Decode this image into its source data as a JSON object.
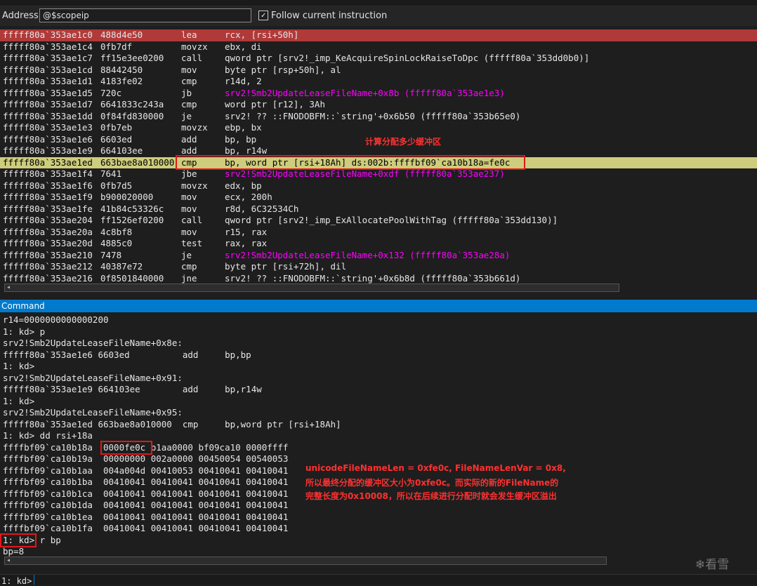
{
  "address_bar": {
    "label": "Address:",
    "value": "@$scopeip",
    "follow_checked": "✓",
    "follow_label": "Follow current instruction"
  },
  "disassembly": [
    {
      "addr": "fffff80a`353ae1c0",
      "bytes": "488d4e50",
      "mn": "lea",
      "op": "rcx, [rsi+50h]",
      "state": "current"
    },
    {
      "addr": "fffff80a`353ae1c4",
      "bytes": "0fb7df",
      "mn": "movzx",
      "op": "ebx, di"
    },
    {
      "addr": "fffff80a`353ae1c7",
      "bytes": "ff15e3ee0200",
      "mn": "call",
      "op": "qword ptr [srv2!_imp_KeAcquireSpinLockRaiseToDpc (fffff80a`353dd0b0)]"
    },
    {
      "addr": "fffff80a`353ae1cd",
      "bytes": "88442450",
      "mn": "mov",
      "op": "byte ptr [rsp+50h], al"
    },
    {
      "addr": "fffff80a`353ae1d1",
      "bytes": "4183fe02",
      "mn": "cmp",
      "op": "r14d, 2"
    },
    {
      "addr": "fffff80a`353ae1d5",
      "bytes": "720c",
      "mn": "jb",
      "op": "srv2!Smb2UpdateLeaseFileName+0x8b (fffff80a`353ae1e3)",
      "sym": true
    },
    {
      "addr": "fffff80a`353ae1d7",
      "bytes": "6641833c243a",
      "mn": "cmp",
      "op": "word ptr [r12], 3Ah"
    },
    {
      "addr": "fffff80a`353ae1dd",
      "bytes": "0f84fd830000",
      "mn": "je",
      "op": "srv2! ?? ::FNODOBFM::`string'+0x6b50 (fffff80a`353b65e0)"
    },
    {
      "addr": "fffff80a`353ae1e3",
      "bytes": "0fb7eb",
      "mn": "movzx",
      "op": "ebp, bx"
    },
    {
      "addr": "fffff80a`353ae1e6",
      "bytes": "6603ed",
      "mn": "add",
      "op": "bp, bp"
    },
    {
      "addr": "fffff80a`353ae1e9",
      "bytes": "664103ee",
      "mn": "add",
      "op": "bp, r14w"
    },
    {
      "addr": "fffff80a`353ae1ed",
      "bytes": "663bae8a010000",
      "mn": "cmp",
      "op": "bp, word ptr [rsi+18Ah] ds:002b:ffffbf09`ca10b18a=fe0c",
      "state": "highlight"
    },
    {
      "addr": "fffff80a`353ae1f4",
      "bytes": "7641",
      "mn": "jbe",
      "op": "srv2!Smb2UpdateLeaseFileName+0xdf (fffff80a`353ae237)",
      "sym": true
    },
    {
      "addr": "fffff80a`353ae1f6",
      "bytes": "0fb7d5",
      "mn": "movzx",
      "op": "edx, bp"
    },
    {
      "addr": "fffff80a`353ae1f9",
      "bytes": "b900020000",
      "mn": "mov",
      "op": "ecx, 200h"
    },
    {
      "addr": "fffff80a`353ae1fe",
      "bytes": "41b84c53326c",
      "mn": "mov",
      "op": "r8d, 6C32534Ch"
    },
    {
      "addr": "fffff80a`353ae204",
      "bytes": "ff1526ef0200",
      "mn": "call",
      "op": "qword ptr [srv2!_imp_ExAllocatePoolWithTag (fffff80a`353dd130)]"
    },
    {
      "addr": "fffff80a`353ae20a",
      "bytes": "4c8bf8",
      "mn": "mov",
      "op": "r15, rax"
    },
    {
      "addr": "fffff80a`353ae20d",
      "bytes": "4885c0",
      "mn": "test",
      "op": "rax, rax"
    },
    {
      "addr": "fffff80a`353ae210",
      "bytes": "7478",
      "mn": "je",
      "op": "srv2!Smb2UpdateLeaseFileName+0x132 (fffff80a`353ae28a)",
      "sym": true
    },
    {
      "addr": "fffff80a`353ae212",
      "bytes": "40387e72",
      "mn": "cmp",
      "op": "byte ptr [rsi+72h], dil"
    },
    {
      "addr": "fffff80a`353ae216",
      "bytes": "0f8501840000",
      "mn": "jne",
      "op": "srv2! ?? ::FNODOBFM::`string'+0x6b8d (fffff80a`353b661d)"
    }
  ],
  "annotation_top": "计算分配多少缓冲区",
  "command": {
    "title": "Command",
    "lines": [
      "r14=0000000000000200",
      "1: kd> p",
      "srv2!Smb2UpdateLeaseFileName+0x8e:",
      "fffff80a`353ae1e6 6603ed          add     bp,bp",
      "1: kd>",
      "srv2!Smb2UpdateLeaseFileName+0x91:",
      "fffff80a`353ae1e9 664103ee        add     bp,r14w",
      "1: kd>",
      "srv2!Smb2UpdateLeaseFileName+0x95:",
      "fffff80a`353ae1ed 663bae8a010000  cmp     bp,word ptr [rsi+18Ah]",
      "1: kd> dd rsi+18a",
      "ffffbf09`ca10b18a  0000fe0c b1aa0000 bf09ca10 0000ffff",
      "ffffbf09`ca10b19a  00000000 002a0000 00450054 00540053",
      "ffffbf09`ca10b1aa  004a004d 00410053 00410041 00410041",
      "ffffbf09`ca10b1ba  00410041 00410041 00410041 00410041",
      "ffffbf09`ca10b1ca  00410041 00410041 00410041 00410041",
      "ffffbf09`ca10b1da  00410041 00410041 00410041 00410041",
      "ffffbf09`ca10b1ea  00410041 00410041 00410041 00410041",
      "ffffbf09`ca10b1fa  00410041 00410041 00410041 00410041",
      "1: kd> r bp",
      "bp=8"
    ],
    "annotation": [
      "unicodeFileNameLen = 0xfe0c, FileNameLenVar = 0x8,",
      "所以最终分配的缓冲区大小为0xfe0c。而实际的新的FileName的",
      "完整长度为0x10008，所以在后续进行分配时就会发生缓冲区溢出"
    ],
    "prompt": "1: kd>"
  },
  "watermark": "❄看雪"
}
